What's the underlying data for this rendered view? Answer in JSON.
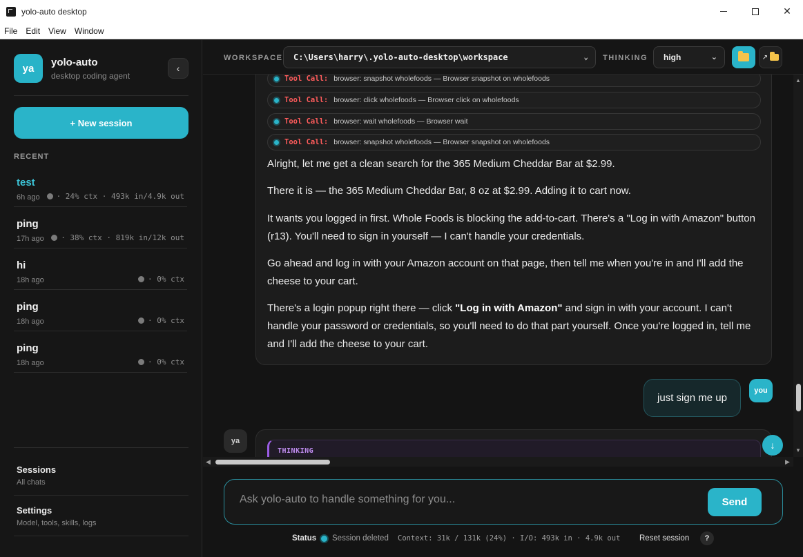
{
  "window": {
    "title": "yolo-auto desktop"
  },
  "menu": [
    "File",
    "Edit",
    "View",
    "Window"
  ],
  "sidebar": {
    "avatar": "ya",
    "brand_name": "yolo-auto",
    "brand_sub": "desktop coding agent",
    "new_session": "+ New session",
    "recent_label": "RECENT",
    "sessions": [
      {
        "name": "test",
        "time": "6h ago",
        "meta": "· 24% ctx · 493k in/4.9k out"
      },
      {
        "name": "ping",
        "time": "17h ago",
        "meta": "· 38% ctx · 819k in/12k out"
      },
      {
        "name": "hi",
        "time": "18h ago",
        "meta": "· 0% ctx"
      },
      {
        "name": "ping",
        "time": "18h ago",
        "meta": "· 0% ctx"
      },
      {
        "name": "ping",
        "time": "18h ago",
        "meta": "· 0% ctx"
      }
    ],
    "links": [
      {
        "title": "Sessions",
        "sub": "All chats"
      },
      {
        "title": "Settings",
        "sub": "Model, tools, skills, logs"
      }
    ]
  },
  "header": {
    "workspace_label": "WORKSPACE",
    "workspace_value": "C:\\Users\\harry\\.yolo-auto-desktop\\workspace",
    "thinking_label": "THINKING",
    "thinking_value": "high",
    "open_folder_icon": "folder-icon",
    "external_folder_icon": "open-external-folder-icon"
  },
  "chat": {
    "tool_calls": [
      {
        "label": "Tool Call:",
        "text": "browser: snapshot wholefoods — Browser snapshot on wholefoods"
      },
      {
        "label": "Tool Call:",
        "text": "browser: click wholefoods — Browser click on wholefoods"
      },
      {
        "label": "Tool Call:",
        "text": "browser: wait wholefoods — Browser wait"
      },
      {
        "label": "Tool Call:",
        "text": "browser: snapshot wholefoods — Browser snapshot on wholefoods"
      }
    ],
    "paragraphs": [
      "Alright, let me get a clean search for the 365 Medium Cheddar Bar at $2.99.",
      "There it is — the 365 Medium Cheddar Bar, 8 oz at $2.99. Adding it to cart now.",
      "It wants you logged in first. Whole Foods is blocking the add-to-cart. There's a \"Log in with Amazon\" button (r13). You'll need to sign in yourself — I can't handle your credentials.",
      "Go ahead and log in with your Amazon account on that page, then tell me when you're in and I'll add the cheese to your cart."
    ],
    "last_para_pre": "There's a login popup right there — click ",
    "last_para_bold": "\"Log in with Amazon\"",
    "last_para_post": " and sign in with your account. I can't handle your password or credentials, so you'll need to do that part yourself. Once you're logged in, tell me and I'll add the cheese to your cart.",
    "user_message": "just sign me up",
    "user_badge": "you",
    "agent_badge": "ya",
    "thinking_label": "THINKING",
    "scroll_down": "↓"
  },
  "composer": {
    "placeholder": "Ask yolo-auto to handle something for you...",
    "send": "Send"
  },
  "status": {
    "label": "Status",
    "text": "Session deleted",
    "context": "Context: 31k / 131k (24%) · I/O: 493k in · 4.9k out",
    "reset": "Reset session",
    "help": "?"
  },
  "colors": {
    "accent": "#2ab4c9",
    "tool_label": "#ff5c5c",
    "thinking": "#9b5de5"
  }
}
